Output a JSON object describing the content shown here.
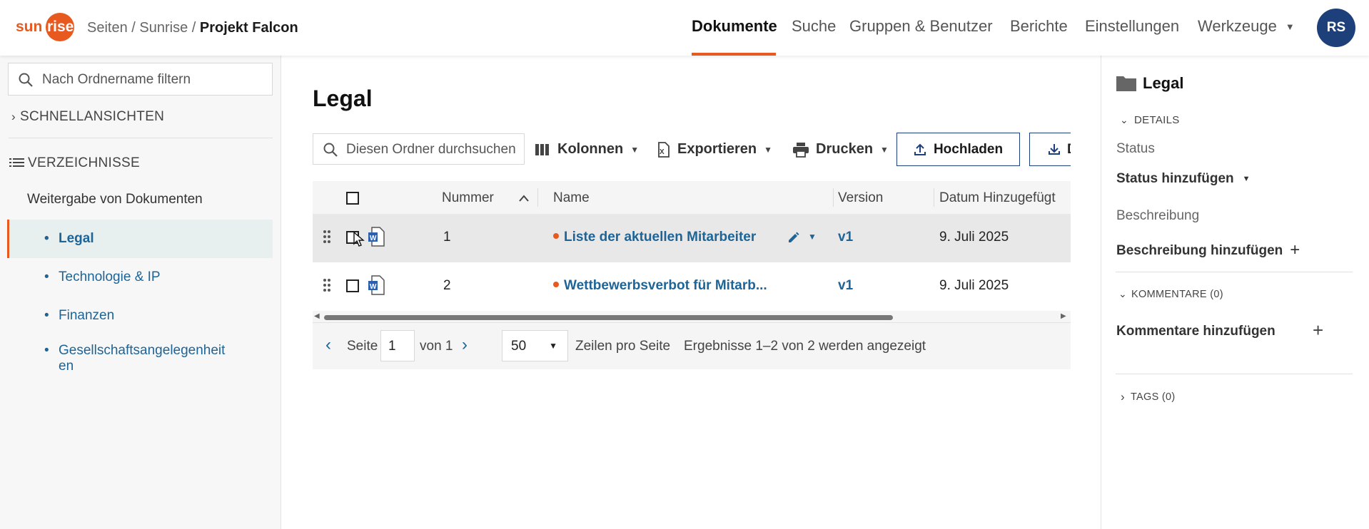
{
  "header": {
    "logo_text": "sunrise",
    "breadcrumb": {
      "part1": "Seiten",
      "sep1": " / ",
      "part2": "Sunrise",
      "sep2": " / ",
      "current": "Projekt Falcon"
    },
    "nav": [
      "Dokumente",
      "Suche",
      "Gruppen & Benutzer",
      "Berichte",
      "Einstellungen",
      "Werkzeuge"
    ],
    "avatar_initials": "RS",
    "accent_color": "#e8591f"
  },
  "sidebar": {
    "filter_placeholder": "Nach Ordnername filtern",
    "quick_views": "SCHNELLANSICHTEN",
    "directories": "VERZEICHNISSE",
    "root": "Weitergabe von Dokumenten",
    "items": [
      {
        "label": "Legal",
        "active": true
      },
      {
        "label": "Technologie & IP"
      },
      {
        "label": "Finanzen"
      },
      {
        "label": "Gesellschaftsangelegenheit",
        "label2": "en"
      }
    ]
  },
  "main": {
    "title": "Legal",
    "search_placeholder": "Diesen Ordner durchsuchen",
    "toolbar": {
      "columns": "Kolonnen",
      "export": "Exportieren",
      "print": "Drucken",
      "upload": "Hochladen"
    },
    "table": {
      "headers": {
        "number": "Nummer",
        "name": "Name",
        "version": "Version",
        "date": "Datum Hinzugefügt"
      },
      "rows": [
        {
          "number": "1",
          "name": "Liste der aktuellen Mitarbeiter",
          "version": "v1",
          "date": "9. Juli 2025"
        },
        {
          "number": "2",
          "name": "Wettbewerbsverbot für Mitarb...",
          "version": "v1",
          "date": "9. Juli 2025"
        }
      ]
    },
    "pager": {
      "page_label": "Seite",
      "page_value": "1",
      "of_label": "von 1",
      "rows_value": "50",
      "rows_label": "Zeilen pro Seite",
      "results": "Ergebnisse 1–2 von 2 werden angezeigt"
    }
  },
  "panel": {
    "title": "Legal",
    "details": "DETAILS",
    "status_label": "Status",
    "status_add": "Status hinzufügen",
    "desc_label": "Beschreibung",
    "desc_add": "Beschreibung hinzufügen",
    "comments": "KOMMENTARE (0)",
    "comments_add": "Kommentare hinzufügen",
    "tags": "TAGS (0)"
  }
}
